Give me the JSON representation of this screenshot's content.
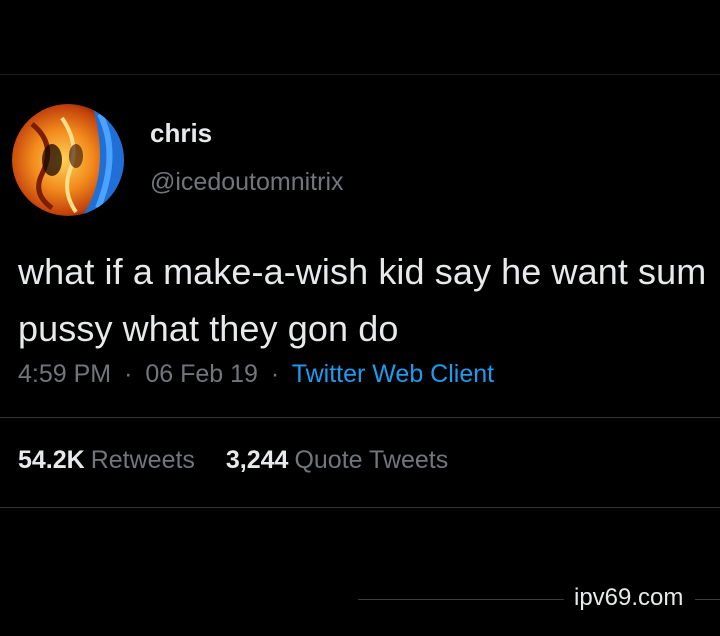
{
  "tweet": {
    "author": {
      "display_name": "chris",
      "handle": "@icedoutomnitrix"
    },
    "text": "what if a make-a-wish kid say he want sum pussy what they gon do",
    "time": "4:59 PM",
    "separator": "·",
    "date": "06 Feb 19",
    "client": "Twitter Web Client",
    "stats": {
      "retweets_count": "54.2K",
      "retweets_label": "Retweets",
      "quotes_count": "3,244",
      "quotes_label": "Quote Tweets"
    }
  },
  "watermark": "ipv69.com",
  "colors": {
    "background": "#000000",
    "text_primary": "#e7e9ea",
    "text_secondary": "#71767b",
    "accent": "#1d9bf0",
    "divider": "#2f3336"
  },
  "icons": {
    "avatar": "profile-avatar"
  }
}
